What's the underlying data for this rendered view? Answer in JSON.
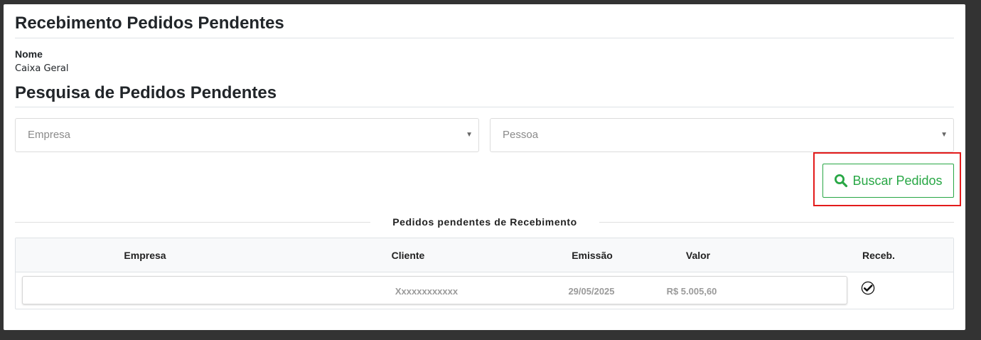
{
  "page": {
    "title": "Recebimento Pedidos Pendentes",
    "nome_label": "Nome",
    "nome_value": "Caixa Geral",
    "search_title": "Pesquisa de Pedidos Pendentes"
  },
  "filters": {
    "empresa_placeholder": "Empresa",
    "pessoa_placeholder": "Pessoa",
    "caret": "▼"
  },
  "search_button": {
    "label": "Buscar Pedidos",
    "icon": "search-icon",
    "color": "#28a745"
  },
  "section_divider": "Pedidos pendentes de Recebimento",
  "table": {
    "columns": [
      "Empresa",
      "Cliente",
      "Emissão",
      "Valor",
      "Receb."
    ],
    "rows": [
      {
        "empresa": "",
        "cliente": "Xxxxxxxxxxxx",
        "emissao": "29/05/2025",
        "valor": "R$ 5.005,60",
        "receb_icon": "check-circle-icon"
      }
    ]
  },
  "colors": {
    "highlight_border": "#e31b1b",
    "background": "#333333"
  }
}
